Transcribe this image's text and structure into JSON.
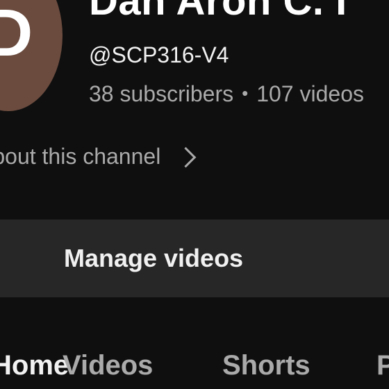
{
  "channel": {
    "avatar_letter": "D",
    "name": "Dan Aron C. I",
    "handle": "@SCP316-V4",
    "subscribers": "38 subscribers",
    "separator": "•",
    "videos": "107 videos",
    "about_link": "About this channel"
  },
  "actions": {
    "manage_videos_label": "Manage videos"
  },
  "tabs": [
    {
      "label": "Home",
      "active": true
    },
    {
      "label": "Videos",
      "active": false
    },
    {
      "label": "Shorts",
      "active": false
    },
    {
      "label": "Playlists",
      "active": false
    }
  ],
  "colors": {
    "background": "#0f0f0f",
    "avatar": "#6b4b3e",
    "button": "#272727",
    "secondary_text": "#aaaaaa"
  }
}
